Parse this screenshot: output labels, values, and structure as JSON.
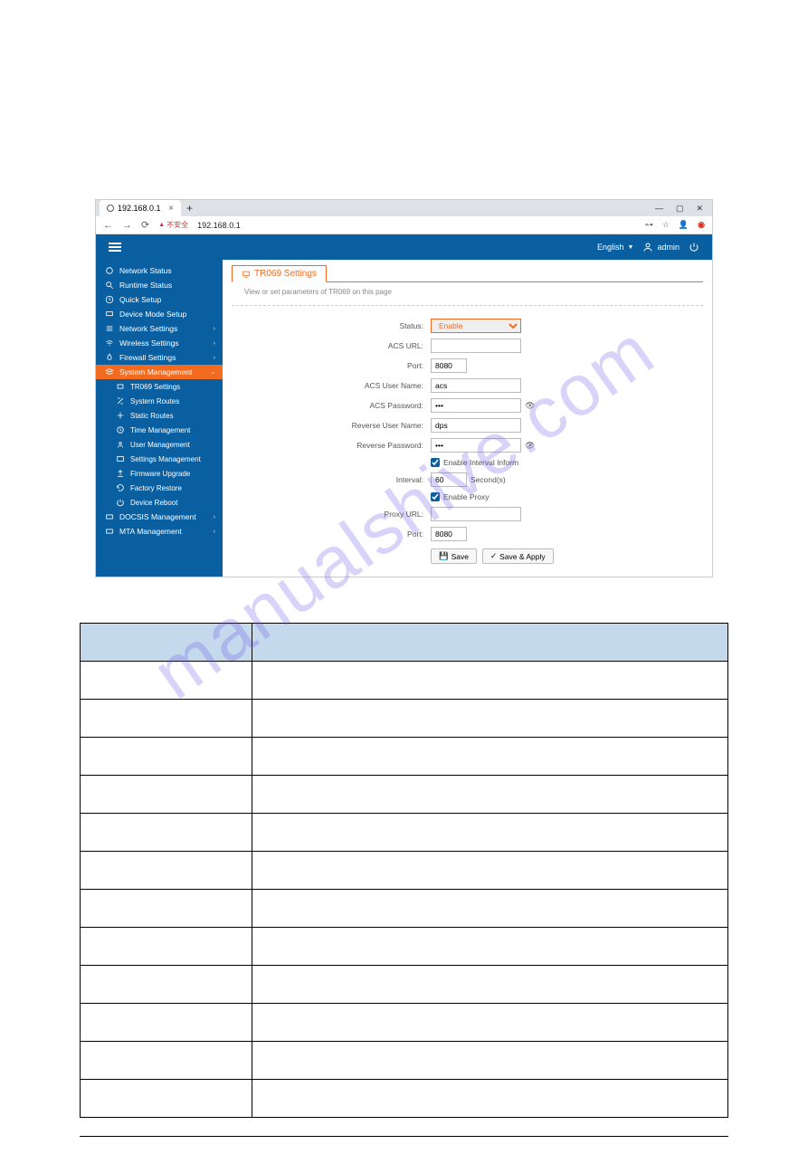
{
  "watermark": "manualshive.com",
  "browser": {
    "tab_title": "192.168.0.1",
    "address_warn": "不安全",
    "address_url": "192.168.0.1",
    "key_icon_label": "⊶"
  },
  "header": {
    "language": "English",
    "username": "admin"
  },
  "sidebar": {
    "items": [
      {
        "label": "Network Status",
        "icon": "status"
      },
      {
        "label": "Runtime Status",
        "icon": "search"
      },
      {
        "label": "Quick Setup",
        "icon": "quick"
      },
      {
        "label": "Device Mode Setup",
        "icon": "device"
      },
      {
        "label": "Network Settings",
        "icon": "net",
        "chev": true
      },
      {
        "label": "Wireless Settings",
        "icon": "wifi",
        "chev": true
      },
      {
        "label": "Firewall Settings",
        "icon": "fire",
        "chev": true
      },
      {
        "label": "System Management",
        "icon": "layers",
        "chev": true,
        "active": true
      },
      {
        "label": "TR069 Settings",
        "sub": true,
        "icon": "sub-tr"
      },
      {
        "label": "System Routes",
        "sub": true,
        "icon": "sub-route"
      },
      {
        "label": "Static Routes",
        "sub": true,
        "icon": "sub-static"
      },
      {
        "label": "Time Management",
        "sub": true,
        "icon": "sub-time"
      },
      {
        "label": "User Management",
        "sub": true,
        "icon": "sub-user"
      },
      {
        "label": "Settings Management",
        "sub": true,
        "icon": "sub-set"
      },
      {
        "label": "Firmware Upgrade",
        "sub": true,
        "icon": "sub-fw"
      },
      {
        "label": "Factory Restore",
        "sub": true,
        "icon": "sub-restore"
      },
      {
        "label": "Device Reboot",
        "sub": true,
        "icon": "sub-reboot"
      },
      {
        "label": "DOCSIS Management",
        "icon": "docsis",
        "chev": true
      },
      {
        "label": "MTA Management",
        "icon": "mta",
        "chev": true
      }
    ]
  },
  "content": {
    "tab_title": "TR069 Settings",
    "description": "View or set parameters of TR069 on this page",
    "fields": {
      "status_label": "Status:",
      "status_value": "Enable",
      "acs_url_label": "ACS URL:",
      "acs_url_value": "",
      "port1_label": "Port:",
      "port1_value": "8080",
      "acs_user_label": "ACS User Name:",
      "acs_user_value": "acs",
      "acs_pwd_label": "ACS Password:",
      "acs_pwd_value": "•••",
      "rev_user_label": "Reverse User Name:",
      "rev_user_value": "dps",
      "rev_pwd_label": "Reverse Password:",
      "rev_pwd_value": "•••",
      "chk_inform": "Enable Interval Inform",
      "interval_label": "Interval:",
      "interval_value": "60",
      "interval_unit": "Second(s)",
      "chk_proxy": "Enable Proxy",
      "proxy_url_label": "Proxy URL:",
      "proxy_url_value": "",
      "port2_label": "Port:",
      "port2_value": "8080"
    },
    "buttons": {
      "save": "Save",
      "save_apply": "Save & Apply"
    }
  },
  "def_table": {
    "header_item": "",
    "header_desc": ""
  }
}
